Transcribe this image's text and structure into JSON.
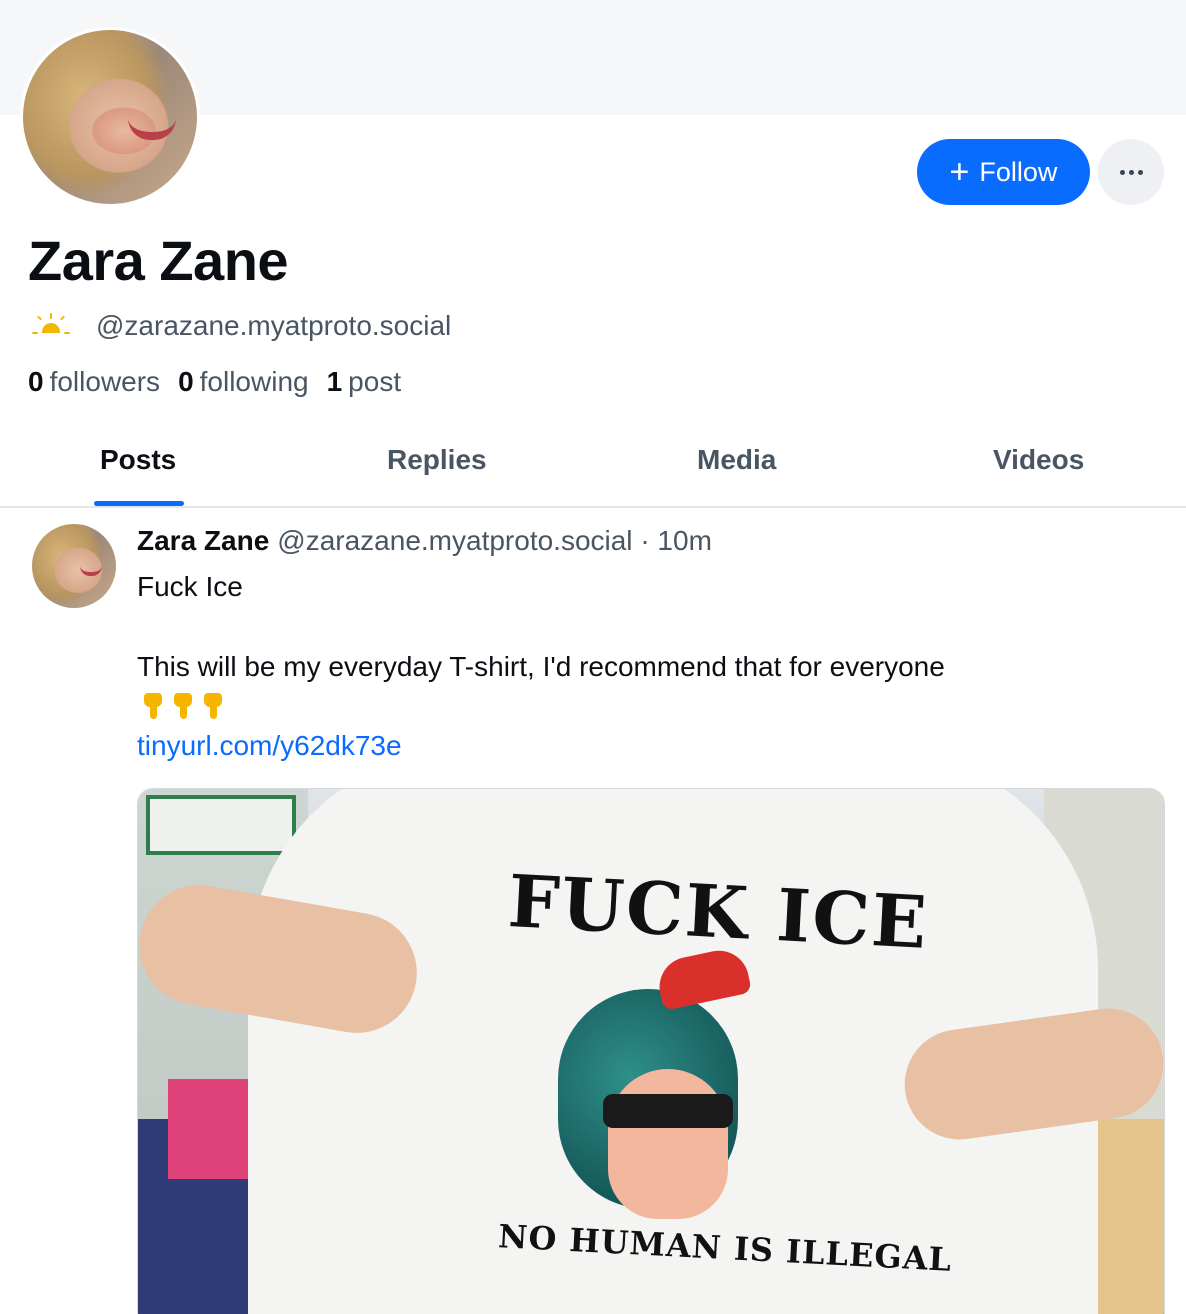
{
  "profile": {
    "display_name": "Zara Zane",
    "handle": "@zarazane.myatproto.social",
    "follow_label": "Follow",
    "stats": {
      "followers_count": "0",
      "followers_label": "followers",
      "following_count": "0",
      "following_label": "following",
      "posts_count": "1",
      "posts_label": "post"
    },
    "icons": {
      "follow": "plus-icon",
      "more": "more-icon",
      "status": "sunrise-icon"
    }
  },
  "tabs": [
    {
      "label": "Posts",
      "active": true
    },
    {
      "label": "Replies",
      "active": false
    },
    {
      "label": "Media",
      "active": false
    },
    {
      "label": "Videos",
      "active": false
    }
  ],
  "post": {
    "author_name": "Zara Zane",
    "author_handle": "@zarazane.myatproto.social",
    "time_separator": "·",
    "time": "10m",
    "line1": "Fuck Ice",
    "line2": "This will be my everyday T-shirt, I'd recommend that for everyone",
    "emojis": "👇👇👇",
    "link": "tinyurl.com/y62dk73e",
    "image": {
      "shirt_text_top": "FUCK ICE",
      "shirt_text_bottom": "NO HUMAN IS ILLEGAL"
    }
  },
  "colors": {
    "accent": "#0a6cff",
    "muted": "#4a5563",
    "text": "#0b0f14"
  }
}
